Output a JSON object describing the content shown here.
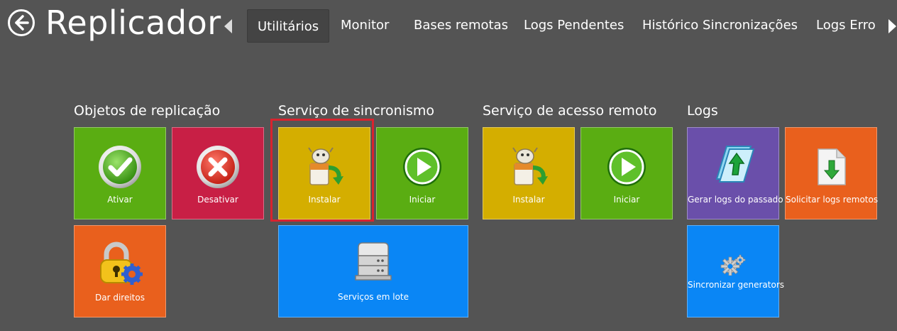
{
  "app": {
    "title": "Replicador"
  },
  "nav": {
    "back_icon": "back-arrow-circle-icon",
    "prev_icon": "chevron-left-icon",
    "next_icon": "chevron-right-icon",
    "tabs": [
      {
        "label": "Utilitários",
        "active": true
      },
      {
        "label": "Monitor",
        "active": false
      },
      {
        "label": "Bases remotas",
        "active": false
      },
      {
        "label": "Logs Pendentes",
        "active": false
      },
      {
        "label": "Histórico Sincronizações",
        "active": false
      },
      {
        "label": "Logs Erro",
        "active": false
      }
    ]
  },
  "groups": {
    "objetos": {
      "title": "Objetos de replicação",
      "tiles": {
        "ativar": {
          "label": "Ativar",
          "color": "#5aad12",
          "icon": "check-circle-icon"
        },
        "desativar": {
          "label": "Desativar",
          "color": "#c81f45",
          "icon": "close-circle-icon"
        },
        "dar_direitos": {
          "label": "Dar direitos",
          "color": "#e9601d",
          "icon": "lock-gear-icon"
        }
      }
    },
    "sincronismo": {
      "title": "Serviço de sincronismo",
      "tiles": {
        "instalar": {
          "label": "Instalar",
          "color": "#d4ae00",
          "icon": "install-package-icon",
          "highlighted": true
        },
        "iniciar": {
          "label": "Iniciar",
          "color": "#5aad12",
          "icon": "play-circle-icon"
        },
        "servicos_lote": {
          "label": "Serviços em lote",
          "color": "#0a86f5",
          "icon": "server-stack-icon"
        }
      }
    },
    "acesso_remoto": {
      "title": "Serviço de acesso remoto",
      "tiles": {
        "instalar": {
          "label": "Instalar",
          "color": "#d4ae00",
          "icon": "install-package-icon"
        },
        "iniciar": {
          "label": "Iniciar",
          "color": "#5aad12",
          "icon": "play-circle-icon"
        }
      }
    },
    "logs": {
      "title": "Logs",
      "tiles": {
        "gerar": {
          "label": "Gerar logs do passado",
          "color": "#6a4faa",
          "icon": "document-upload-icon"
        },
        "solicitar": {
          "label": "Solicitar logs remotos",
          "color": "#e9601d",
          "icon": "document-download-icon"
        },
        "sincronizar": {
          "label": "Sincronizar generators",
          "color": "#0a86f5",
          "icon": "gears-icon"
        }
      }
    }
  },
  "colors": {
    "background": "#545454",
    "highlight_border": "#d9232e",
    "active_tab": "#444444"
  }
}
